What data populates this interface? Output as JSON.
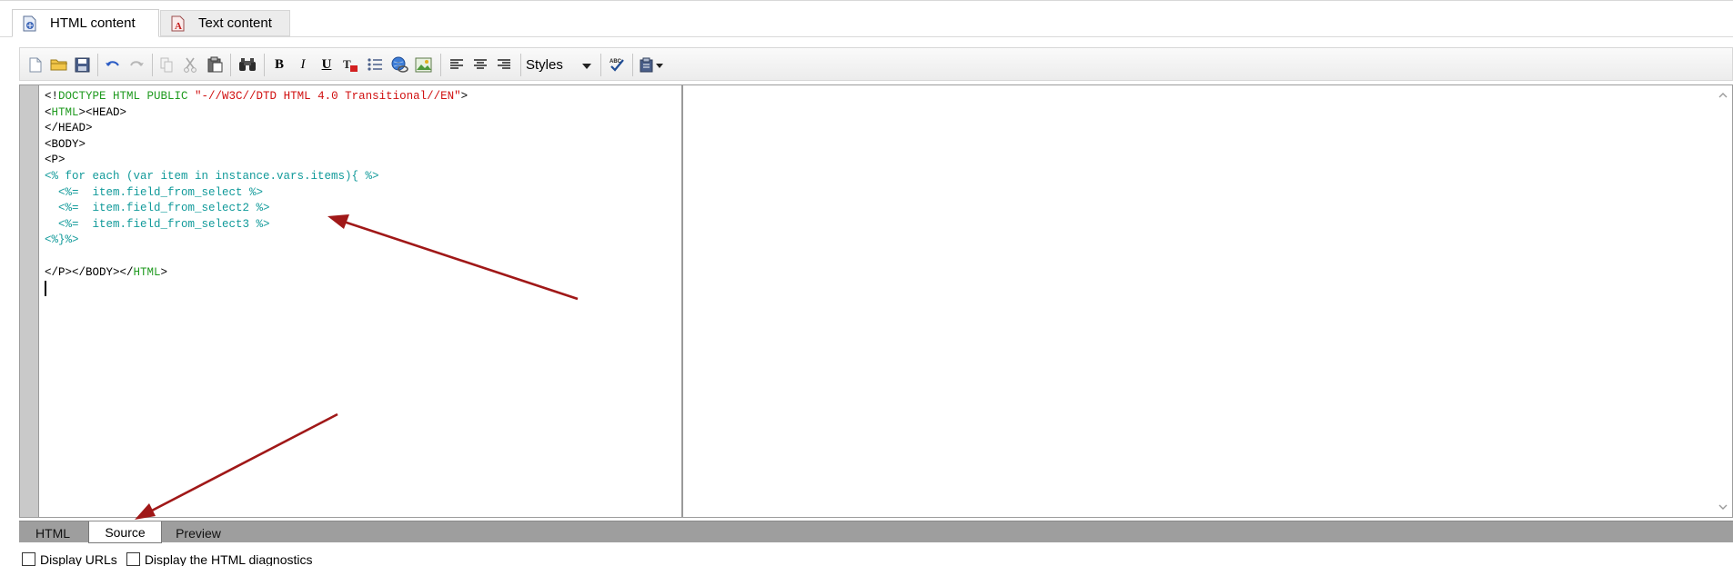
{
  "top_tabs": [
    {
      "label": "HTML content",
      "icon": "html-page-icon",
      "active": true
    },
    {
      "label": "Text content",
      "icon": "text-page-icon",
      "active": false
    }
  ],
  "toolbar": {
    "buttons": [
      "new-document-icon",
      "open-folder-icon",
      "save-icon",
      "undo-icon",
      "redo-icon",
      "copy-icon",
      "cut-icon",
      "paste-icon",
      "find-icon",
      "bold-icon",
      "italic-icon",
      "underline-icon",
      "text-color-icon",
      "bullet-list-icon",
      "insert-link-icon",
      "insert-image-icon",
      "align-left-icon",
      "align-center-icon",
      "align-right-icon",
      "spellcheck-icon",
      "paste-special-icon"
    ],
    "bold_label": "B",
    "italic_label": "I",
    "underline_label": "U",
    "styles_label": "Styles"
  },
  "code_lines": [
    [
      {
        "t": "<!",
        "c": "black"
      },
      {
        "t": "DOCTYPE HTML PUBLIC ",
        "c": "green"
      },
      {
        "t": "\"-//W3C//DTD HTML 4.0 Transitional//EN\"",
        "c": "red"
      },
      {
        "t": ">",
        "c": "black"
      }
    ],
    [
      {
        "t": "<",
        "c": "black"
      },
      {
        "t": "HTML",
        "c": "green"
      },
      {
        "t": "><HEAD>",
        "c": "black"
      }
    ],
    [
      {
        "t": "</HEAD>",
        "c": "black"
      }
    ],
    [
      {
        "t": "<BODY>",
        "c": "black"
      }
    ],
    [
      {
        "t": "<P>",
        "c": "black"
      }
    ],
    [
      {
        "t": "<% for each (var item in instance.vars.items){ %>",
        "c": "teal"
      }
    ],
    [
      {
        "t": "  <%=  item.field_from_select %>",
        "c": "teal"
      }
    ],
    [
      {
        "t": "  <%=  item.field_from_select2 %>",
        "c": "teal"
      }
    ],
    [
      {
        "t": "  <%=  item.field_from_select3 %>",
        "c": "teal"
      }
    ],
    [
      {
        "t": "<%}%>",
        "c": "teal"
      }
    ],
    [],
    [
      {
        "t": "</P></BODY></",
        "c": "black"
      },
      {
        "t": "HTML",
        "c": "green"
      },
      {
        "t": ">",
        "c": "black"
      }
    ]
  ],
  "bottom_tabs": [
    {
      "label": "HTML",
      "active": false
    },
    {
      "label": "Source",
      "active": true
    },
    {
      "label": "Preview",
      "active": false
    }
  ],
  "checkboxes": [
    {
      "label": "Display URLs",
      "checked": false
    },
    {
      "label": "Display the HTML diagnostics",
      "checked": false
    }
  ],
  "colors": {
    "code_black": "#000000",
    "code_green": "#1f9a1f",
    "code_red": "#d01010",
    "code_teal": "#119a9a",
    "arrow": "#a01818",
    "bottom_bar": "#9e9e9e"
  }
}
